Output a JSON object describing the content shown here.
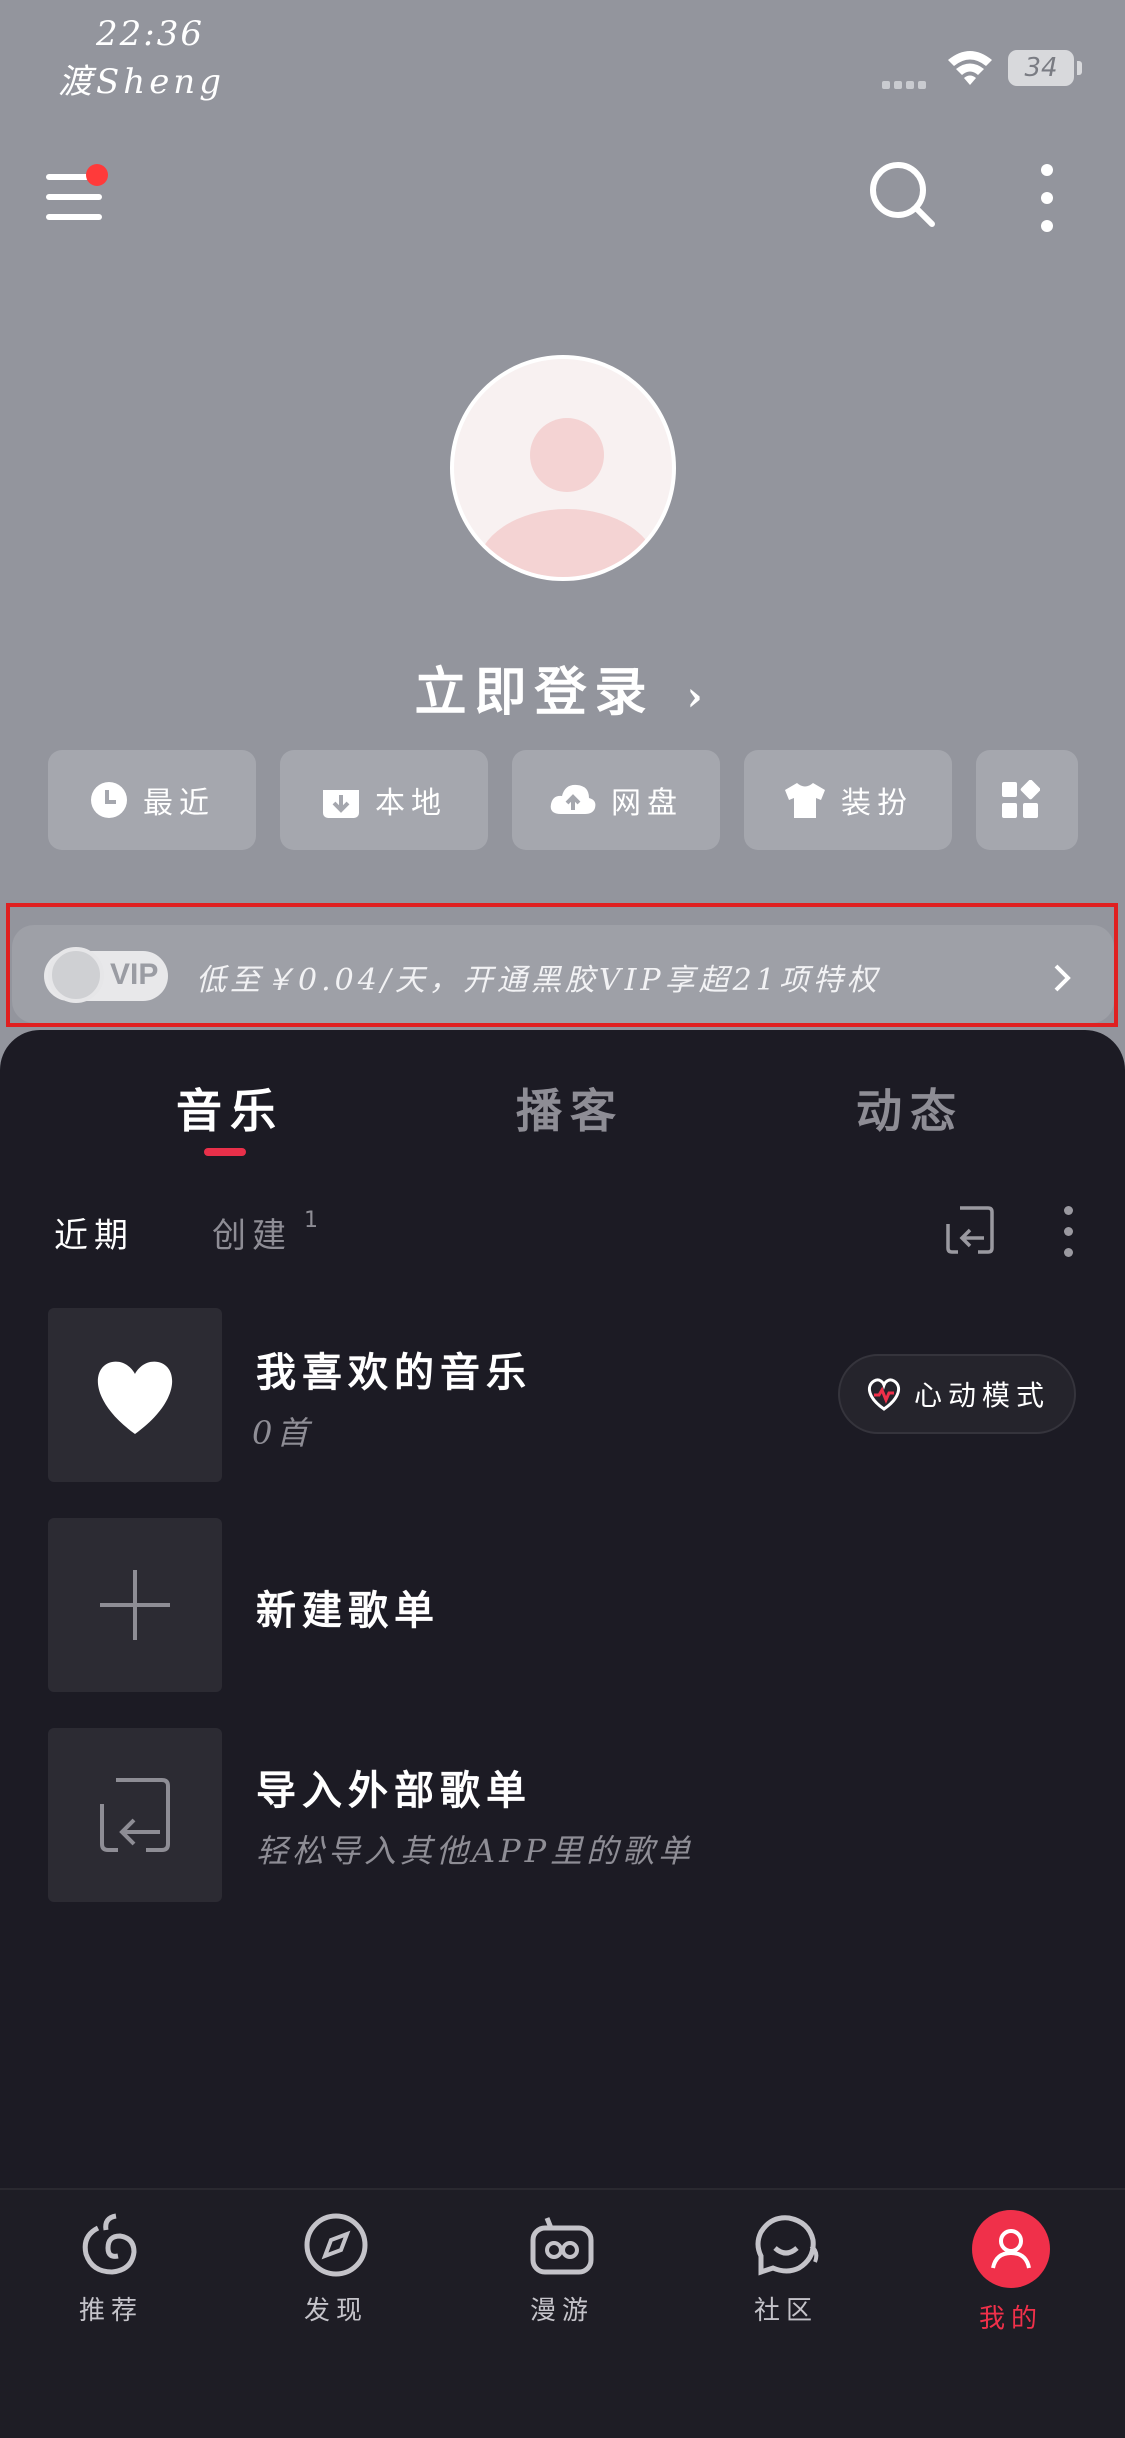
{
  "status_bar": {
    "time": "22:36",
    "carrier_name": "渡Sheng",
    "battery": "34"
  },
  "header": {
    "menu_icon": "hamburger-menu-icon",
    "search_icon": "search-icon",
    "more_icon": "vertical-dots-icon",
    "notification_dot_color": "#ff3a3a"
  },
  "profile": {
    "login_text": "立即登录",
    "login_chevron": "›"
  },
  "quick_actions": [
    {
      "label": "最近",
      "icon": "clock-icon"
    },
    {
      "label": "本地",
      "icon": "download-box-icon"
    },
    {
      "label": "网盘",
      "icon": "cloud-upload-icon"
    },
    {
      "label": "装扮",
      "icon": "tshirt-icon"
    },
    {
      "label": "",
      "icon": "apps-grid-icon"
    }
  ],
  "vip_banner": {
    "badge": "VIP",
    "text": "低至￥0.04/天，开通黑胶VIP享超21项特权"
  },
  "tabs": [
    {
      "label": "音乐",
      "active": true
    },
    {
      "label": "播客",
      "active": false
    },
    {
      "label": "动态",
      "active": false
    }
  ],
  "sub_tabs": {
    "recent": "近期",
    "created": "创建",
    "created_count": "1"
  },
  "playlists": [
    {
      "title": "我喜欢的音乐",
      "subtitle": "0首",
      "icon": "heart-icon"
    },
    {
      "title": "新建歌单",
      "subtitle": "",
      "icon": "plus-icon"
    },
    {
      "title": "导入外部歌单",
      "subtitle": "轻松导入其他APP里的歌单",
      "icon": "import-icon"
    }
  ],
  "heart_mode_button": "心动模式",
  "bottom_nav": [
    {
      "label": "推荐",
      "icon": "netease-music-icon",
      "active": false
    },
    {
      "label": "发现",
      "icon": "compass-icon",
      "active": false
    },
    {
      "label": "漫游",
      "icon": "radio-icon",
      "active": false
    },
    {
      "label": "社区",
      "icon": "chat-bubbles-icon",
      "active": false
    },
    {
      "label": "我的",
      "icon": "user-icon",
      "active": true
    }
  ],
  "colors": {
    "accent": "#f0304a",
    "top_background": "#93959d",
    "dark_background": "#1c1b24"
  }
}
